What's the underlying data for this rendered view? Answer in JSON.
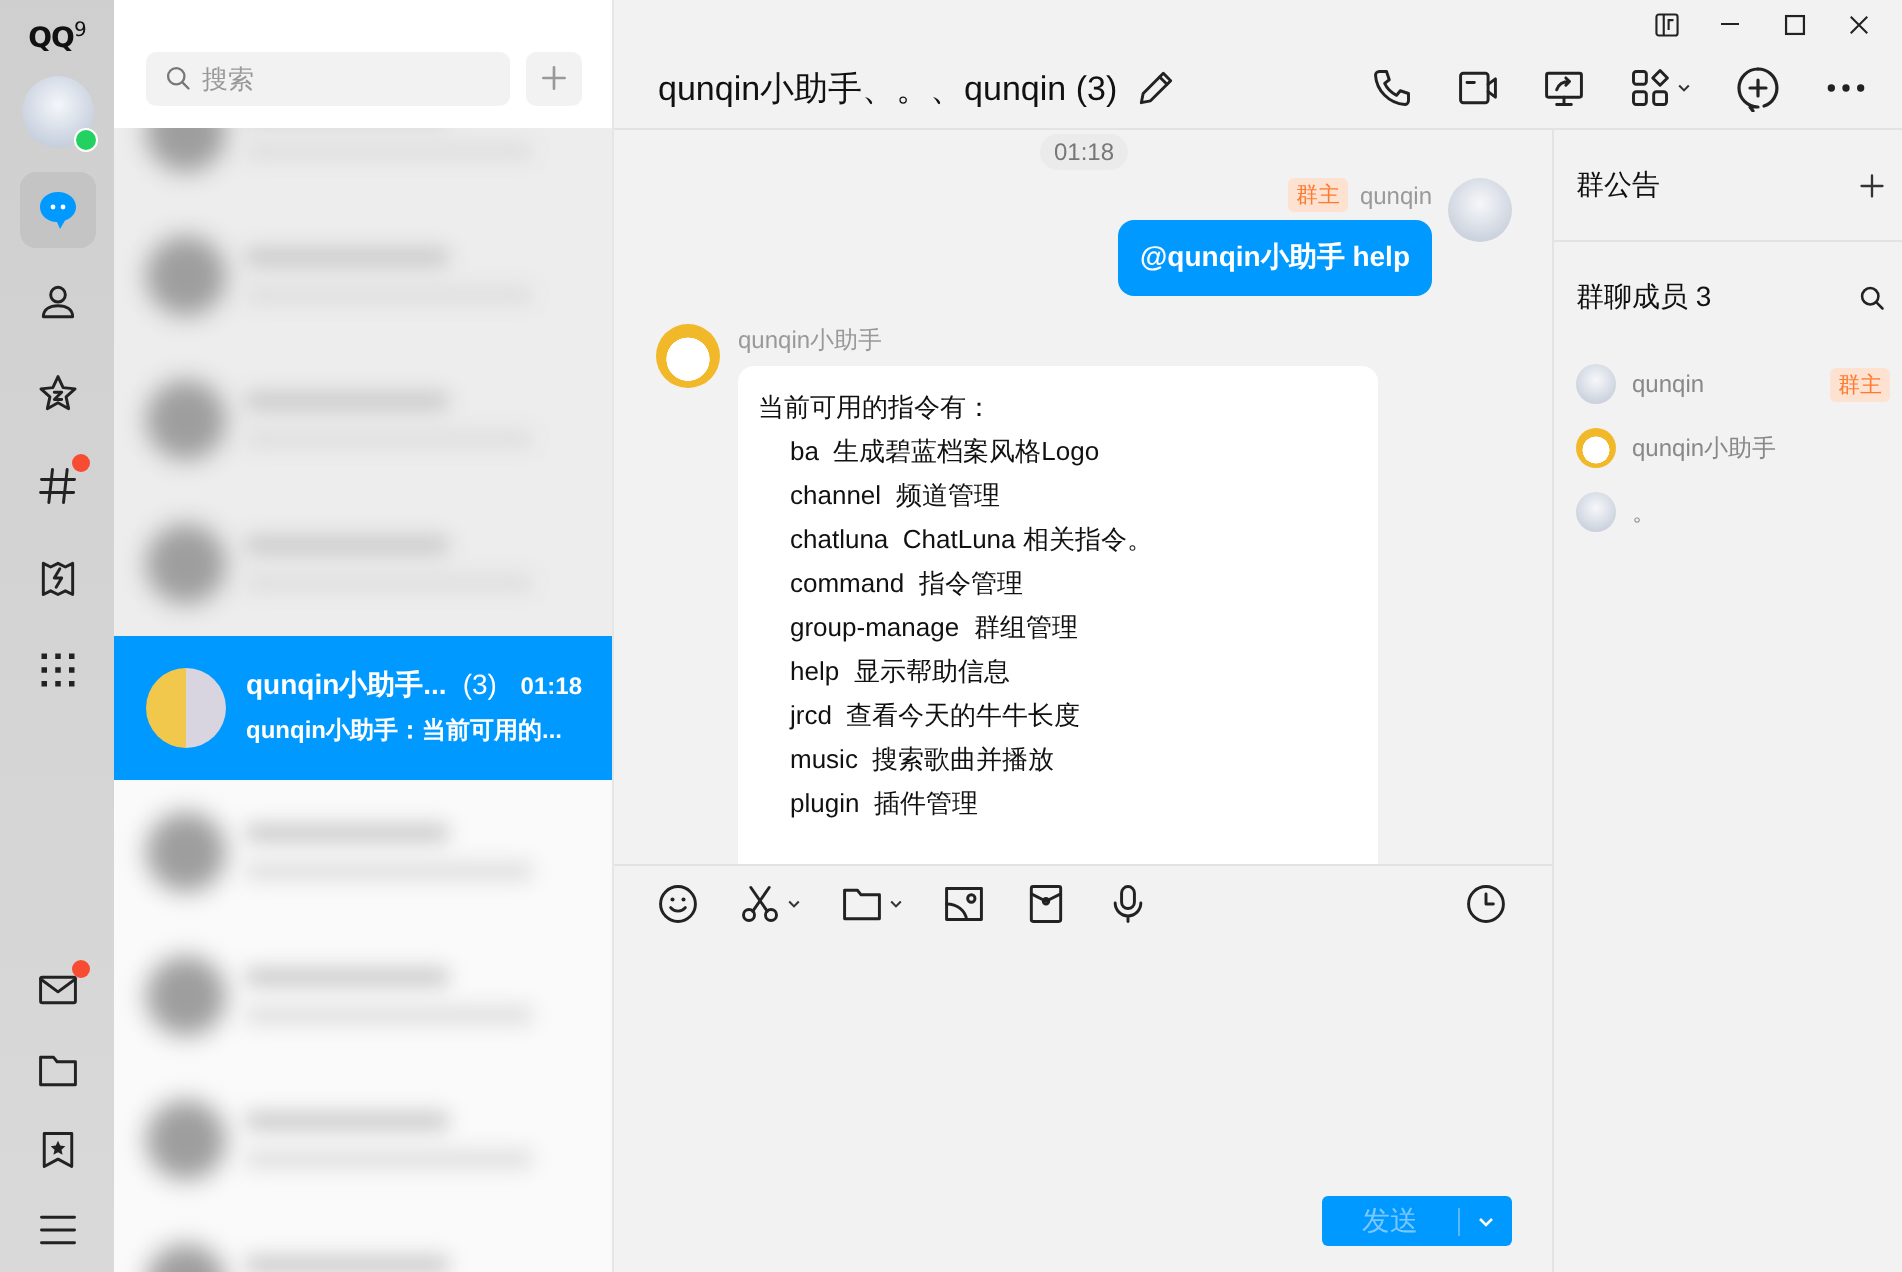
{
  "app": {
    "logo": "QQ$^{9}$"
  },
  "nav": {
    "top": [
      {
        "kind": "chat",
        "selected": true,
        "badge": false
      },
      {
        "kind": "contacts",
        "selected": false,
        "badge": false
      },
      {
        "kind": "favorites",
        "selected": false,
        "badge": false
      },
      {
        "kind": "channels",
        "selected": false,
        "badge": true
      },
      {
        "kind": "games",
        "selected": false,
        "badge": false
      },
      {
        "kind": "apps",
        "selected": false,
        "badge": false
      }
    ],
    "bottom": [
      {
        "kind": "mail",
        "selected": false,
        "badge": true
      },
      {
        "kind": "files",
        "selected": false,
        "badge": false
      },
      {
        "kind": "saved",
        "selected": false,
        "badge": false
      },
      {
        "kind": "menu",
        "selected": false,
        "badge": false
      }
    ]
  },
  "search": {
    "placeholder": "搜索"
  },
  "conversations": [
    {
      "kind": "blurred",
      "selected": false
    },
    {
      "kind": "blurred",
      "selected": false
    },
    {
      "kind": "blurred",
      "selected": false
    },
    {
      "kind": "blurred",
      "selected": false
    },
    {
      "kind": "chat",
      "selected": true,
      "name": "qunqin小助手...",
      "count": "(3)",
      "time": "01:18",
      "preview": "qunqin小助手：当前可用的..."
    },
    {
      "kind": "blurred",
      "selected": false
    },
    {
      "kind": "blurred",
      "selected": false
    },
    {
      "kind": "blurred",
      "selected": false
    },
    {
      "kind": "blurred",
      "selected": false
    }
  ],
  "chat": {
    "title": "qunqin小助手、。、qunqin (3)",
    "messages": [
      {
        "kind": "time",
        "text": "01:18"
      },
      {
        "kind": "outgoing",
        "role": "群主",
        "sender": "qunqin",
        "text": "@qunqin小助手 help"
      },
      {
        "kind": "incoming",
        "sender": "qunqin小助手",
        "heading": "当前可用的指令有：",
        "lines": [
          "ba  生成碧蓝档案风格Logo",
          "channel  频道管理",
          "chatluna  ChatLuna 相关指令。",
          "command  指令管理",
          "group-manage  群组管理",
          "help  显示帮助信息",
          "jrcd  查看今天的牛牛长度",
          "music  搜索歌曲并播放",
          "plugin  插件管理"
        ]
      }
    ],
    "send_button": {
      "label": "发送",
      "disabled": true
    }
  },
  "group_panel": {
    "notice_title": "群公告",
    "members_title": "群聊成员 3",
    "members": [
      {
        "name": "qunqin",
        "role": "群主"
      },
      {
        "name": "qunqin小助手"
      },
      {
        "name": "。"
      }
    ]
  }
}
